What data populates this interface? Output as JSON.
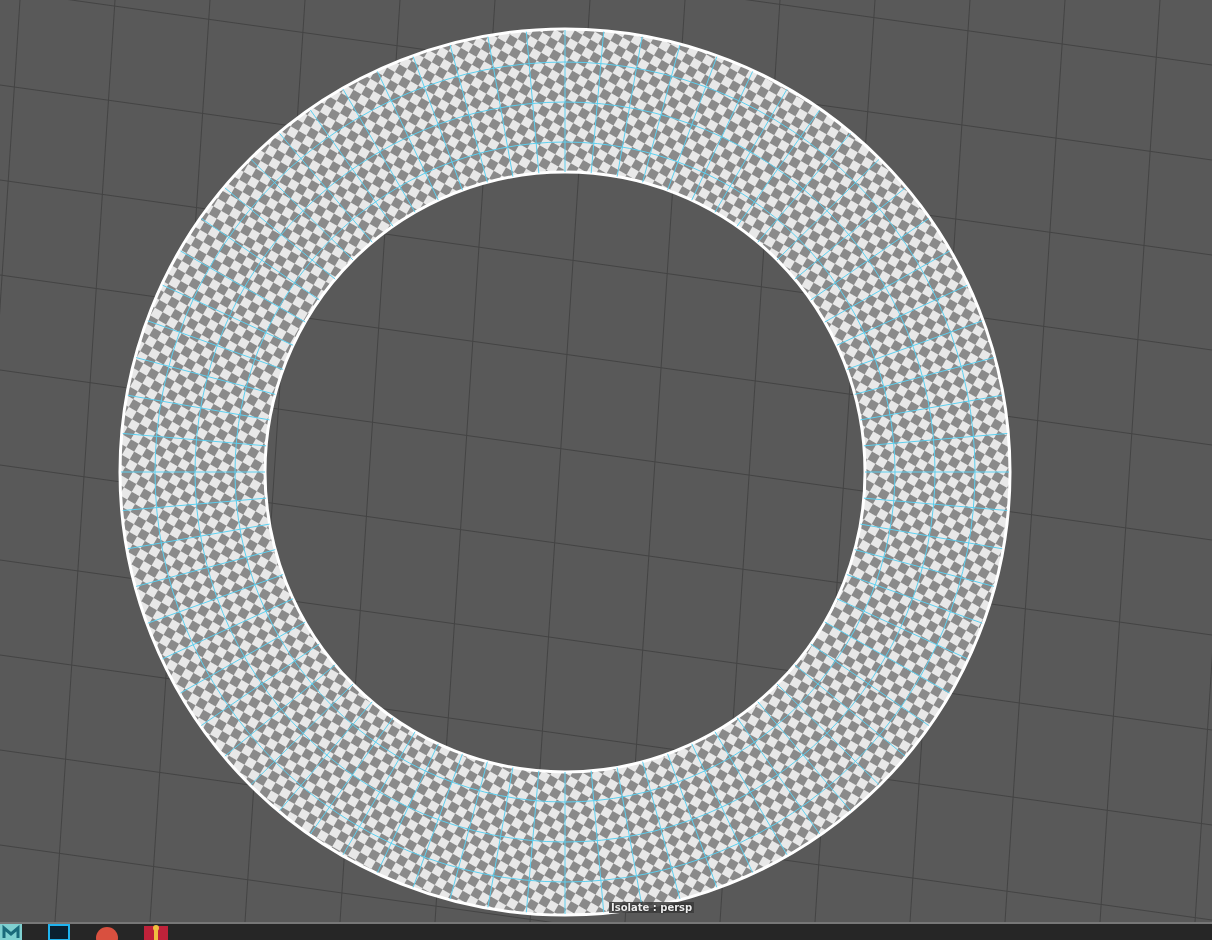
{
  "viewport": {
    "camera_label": "Isolate : persp"
  }
}
